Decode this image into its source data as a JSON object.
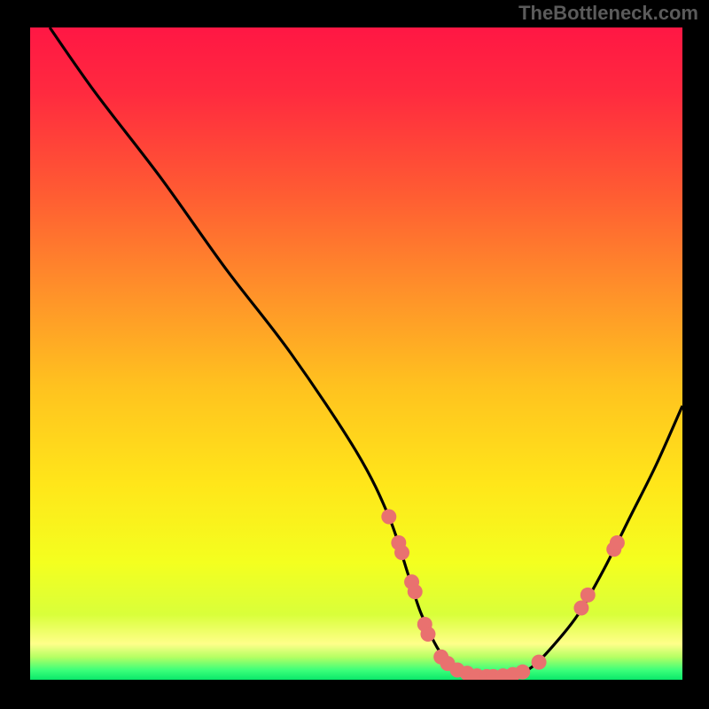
{
  "watermark": "TheBottleneck.com",
  "chart_data": {
    "type": "line",
    "title": "",
    "xlabel": "",
    "ylabel": "",
    "xlim": [
      0,
      100
    ],
    "ylim": [
      0,
      100
    ],
    "series": [
      {
        "name": "curve",
        "x": [
          3,
          10,
          20,
          30,
          40,
          50,
          55,
          58,
          60,
          63,
          66,
          70,
          74,
          77,
          80,
          84,
          88,
          92,
          96,
          100
        ],
        "y": [
          100,
          90,
          77,
          63,
          50,
          35,
          25,
          16,
          10,
          4,
          1.5,
          0.5,
          0.5,
          2,
          5,
          10,
          17,
          25,
          33,
          42
        ]
      }
    ],
    "markers": {
      "name": "highlight-points",
      "color": "#e9716f",
      "points": [
        {
          "x": 55.0,
          "y": 25.0
        },
        {
          "x": 56.5,
          "y": 21.0
        },
        {
          "x": 57.0,
          "y": 19.5
        },
        {
          "x": 58.5,
          "y": 15.0
        },
        {
          "x": 59.0,
          "y": 13.5
        },
        {
          "x": 60.5,
          "y": 8.5
        },
        {
          "x": 61.0,
          "y": 7.0
        },
        {
          "x": 63.0,
          "y": 3.5
        },
        {
          "x": 64.0,
          "y": 2.5
        },
        {
          "x": 65.5,
          "y": 1.5
        },
        {
          "x": 67.0,
          "y": 1.0
        },
        {
          "x": 68.5,
          "y": 0.6
        },
        {
          "x": 70.0,
          "y": 0.5
        },
        {
          "x": 71.0,
          "y": 0.5
        },
        {
          "x": 72.5,
          "y": 0.6
        },
        {
          "x": 74.0,
          "y": 0.8
        },
        {
          "x": 75.5,
          "y": 1.2
        },
        {
          "x": 78.0,
          "y": 2.7
        },
        {
          "x": 84.5,
          "y": 11.0
        },
        {
          "x": 85.5,
          "y": 13.0
        },
        {
          "x": 89.5,
          "y": 20.0
        },
        {
          "x": 90.0,
          "y": 21.0
        }
      ]
    },
    "gradient_stops": [
      {
        "offset": 0.0,
        "color": "#ff1744"
      },
      {
        "offset": 0.1,
        "color": "#ff2a3f"
      },
      {
        "offset": 0.25,
        "color": "#ff5a33"
      },
      {
        "offset": 0.4,
        "color": "#ff8f2a"
      },
      {
        "offset": 0.55,
        "color": "#ffc21f"
      },
      {
        "offset": 0.7,
        "color": "#ffe61a"
      },
      {
        "offset": 0.82,
        "color": "#f4ff1f"
      },
      {
        "offset": 0.9,
        "color": "#d9ff3a"
      },
      {
        "offset": 0.945,
        "color": "#ffff8a"
      },
      {
        "offset": 0.965,
        "color": "#b6ff63"
      },
      {
        "offset": 0.985,
        "color": "#3dff7a"
      },
      {
        "offset": 1.0,
        "color": "#0ae86a"
      }
    ]
  }
}
